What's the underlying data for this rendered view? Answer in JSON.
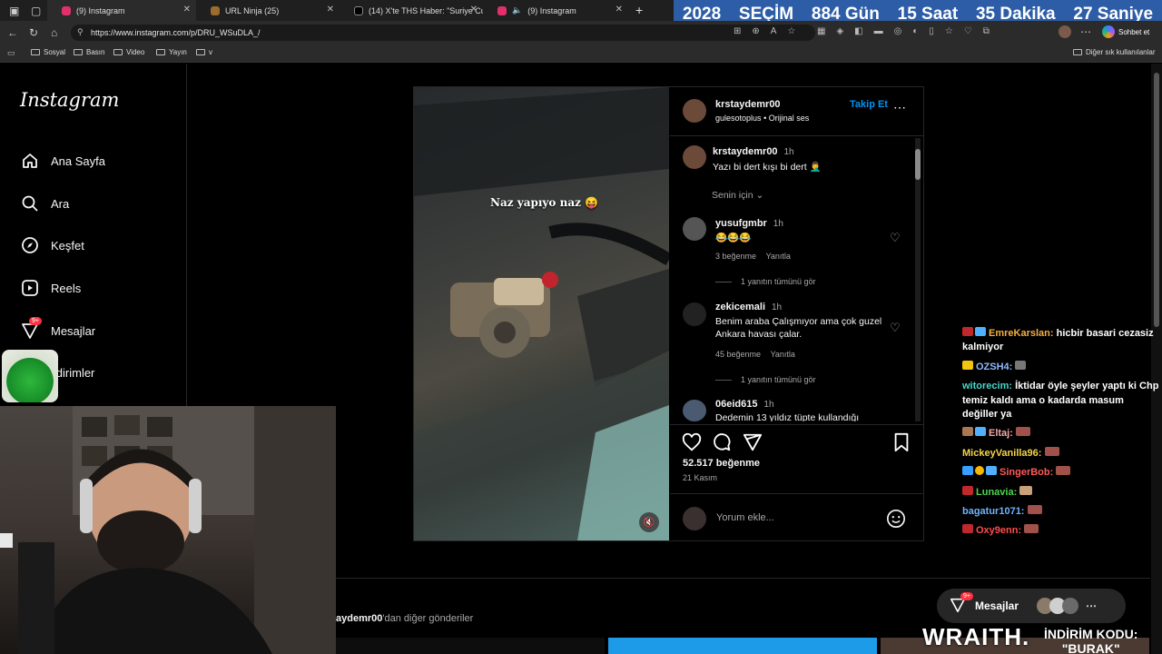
{
  "browser": {
    "tabs": [
      {
        "label": "(9) Instagram",
        "color": "#e1306c"
      },
      {
        "label": "URL Ninja (25)",
        "color": "#9c6b2e"
      },
      {
        "label": "(14) X'te THS Haber: \"Suriye Cum",
        "color": "#000000"
      },
      {
        "label": "(9) Instagram",
        "color": "#e1306c"
      }
    ],
    "new_tab": "+",
    "url": "https://www.instagram.com/p/DRU_WSuDLA_/",
    "bookmarks": [
      "Sosyal",
      "Basın",
      "Video",
      "Yayın",
      "v"
    ],
    "other_bookmarks": "Diğer sık kullanılanlar",
    "chat_button": "Sohbet et"
  },
  "countdown": {
    "year": "2028",
    "label": "SEÇİM",
    "days": "884 Gün",
    "hours": "15 Saat",
    "minutes": "35 Dakika",
    "seconds": "27 Saniye",
    "color": "#2d5da6"
  },
  "instagram": {
    "logo": "Instagram",
    "nav": [
      {
        "label": "Ana Sayfa",
        "icon": "home-icon"
      },
      {
        "label": "Ara",
        "icon": "search-icon"
      },
      {
        "label": "Keşfet",
        "icon": "compass-icon"
      },
      {
        "label": "Reels",
        "icon": "reels-icon"
      },
      {
        "label": "Mesajlar",
        "icon": "messenger-icon",
        "badge": "9+"
      },
      {
        "label": "ildirimler",
        "icon": "heart-icon"
      }
    ],
    "post": {
      "video_caption": "Naz yapıyo naz 😝",
      "author": "krstaydemr00",
      "follow": "Takip Et",
      "audio": "gulesotoplus",
      "audio_separator": "•",
      "audio_title": "Orijinal ses",
      "caption_user": "krstaydemr00",
      "caption_time": "1h",
      "caption_text": "Yazı bi dert kışı bi dert 🤦‍♂️",
      "for_you": "Senin için",
      "comments": [
        {
          "user": "yusufgmbr",
          "time": "1h",
          "text": "😂😂😂",
          "likes": "3 beğenme",
          "reply": "Yanıtla",
          "view_replies": "1 yanıtın tümünü gör"
        },
        {
          "user": "zekicemali",
          "time": "1h",
          "text": "Benim araba Çalışmıyor ama çok guzel Ankara havası çalar.",
          "likes": "45 beğenme",
          "reply": "Yanıtla",
          "view_replies": "1 yanıtın tümünü gör"
        },
        {
          "user": "06eid615",
          "time": "1h",
          "text": "Dedemin 13 yıldız tüpte kullandığı"
        }
      ],
      "like_count": "52.517 beğenme",
      "date": "21 Kasım",
      "comment_placeholder": "Yorum ekle...",
      "more_posts_user": "aydemr00",
      "more_posts_suffix": "'dan diğer gönderiler"
    },
    "messages_bubble": {
      "label": "Mesajlar",
      "badge": "9+"
    }
  },
  "chat": [
    {
      "user": "EmreKarslan:",
      "text": "hicbir basari cezasiz kalmiyor",
      "color": "#f5b041"
    },
    {
      "user": "OZSH4:",
      "text": "",
      "color": "#8fb8ff"
    },
    {
      "user": "witorecim:",
      "text": "İktidar öyle şeyler yaptı ki Chp temiz kaldı ama o kadarda masum değiller ya",
      "color": "#46d7c8"
    },
    {
      "user": "Eltaj:",
      "text": "",
      "color": "#f5a8a8"
    },
    {
      "user": "MickeyVanilla96:",
      "text": "",
      "color": "#f5d547"
    },
    {
      "user": "SingerBob:",
      "text": "",
      "color": "#ff5a5a"
    },
    {
      "user": "Lunavia:",
      "text": "",
      "color": "#4fd24f"
    },
    {
      "user": "bagatur1071:",
      "text": "",
      "color": "#6fb3ff"
    },
    {
      "user": "Oxy9enn:",
      "text": "",
      "color": "#ff4d4d"
    }
  ],
  "sponsor": {
    "brand": "WRAITH.",
    "promo_label": "İNDİRİM KODU:",
    "promo_code": "\"BURAK\""
  }
}
